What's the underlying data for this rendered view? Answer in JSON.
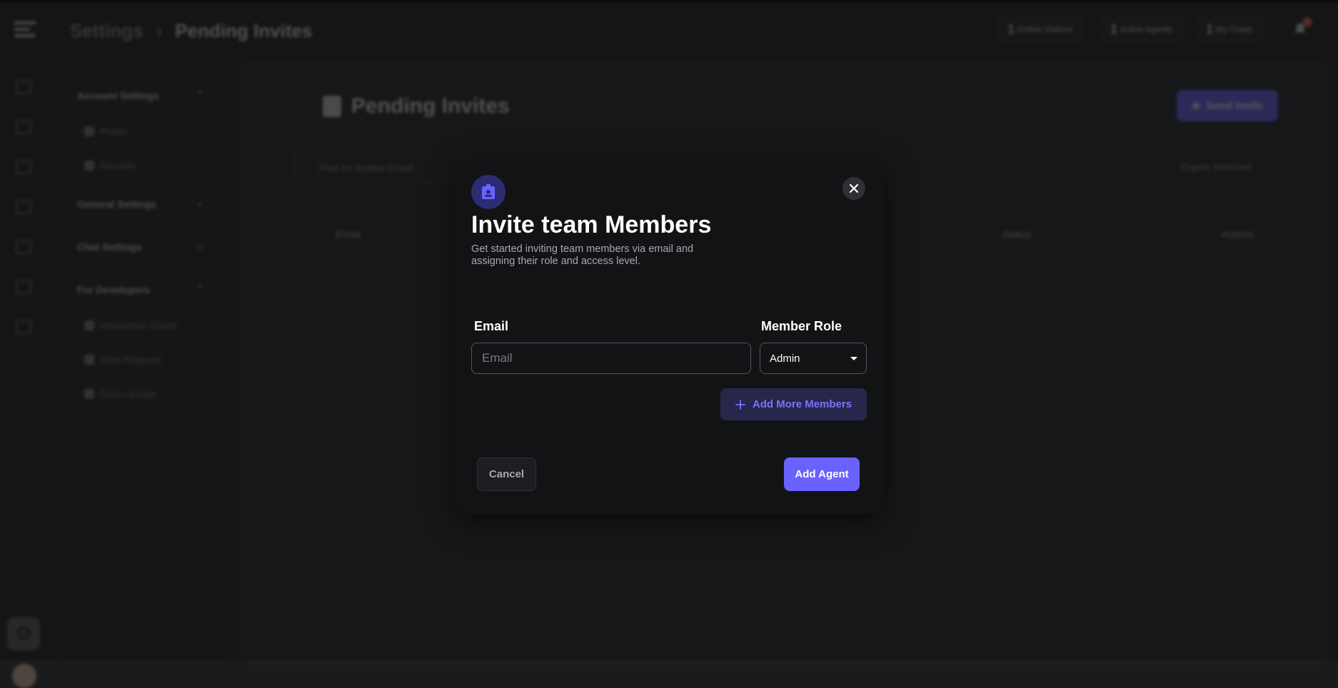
{
  "header": {
    "breadcrumb_root": "Settings",
    "breadcrumb_separator": "›",
    "breadcrumb_current": "Pending Invites",
    "stats": [
      {
        "count": "1",
        "label": "Online Visitors"
      },
      {
        "count": "1",
        "label": "Active Agents"
      },
      {
        "count": "1",
        "label": "My Chats"
      }
    ],
    "notification_count": "1"
  },
  "settings_nav": {
    "sections": [
      {
        "title": "Account Settings",
        "items": [
          "Profile",
          "Security"
        ]
      },
      {
        "title": "General Settings",
        "items": []
      },
      {
        "title": "Chat Settings",
        "items": []
      },
      {
        "title": "For Developers",
        "items": [
          "Installation Guide",
          "Data Request",
          "Data Update"
        ]
      }
    ]
  },
  "main": {
    "title": "Pending Invites",
    "send_invite_label": "Send Invite",
    "search_placeholder": "Find An Invited Email",
    "export_label": "Export Selected",
    "columns": [
      "Email",
      "Status",
      "Actions"
    ]
  },
  "modal": {
    "title": "Invite team Members",
    "description": "Get started inviting team members via email and assigning their role and access level.",
    "email_label": "Email",
    "email_placeholder": "Email",
    "role_label": "Member Role",
    "role_value": "Admin",
    "add_more_label": "Add More Members",
    "cancel_label": "Cancel",
    "submit_label": "Add Agent"
  },
  "colors": {
    "accent": "#6a62ff",
    "modal_bg": "#121315",
    "icon_circle": "#2d2b72"
  },
  "icons": [
    "hamburger-icon",
    "bell-icon",
    "gear-icon",
    "id-badge-icon",
    "close-icon",
    "plus-icon",
    "chevron-down-icon"
  ]
}
